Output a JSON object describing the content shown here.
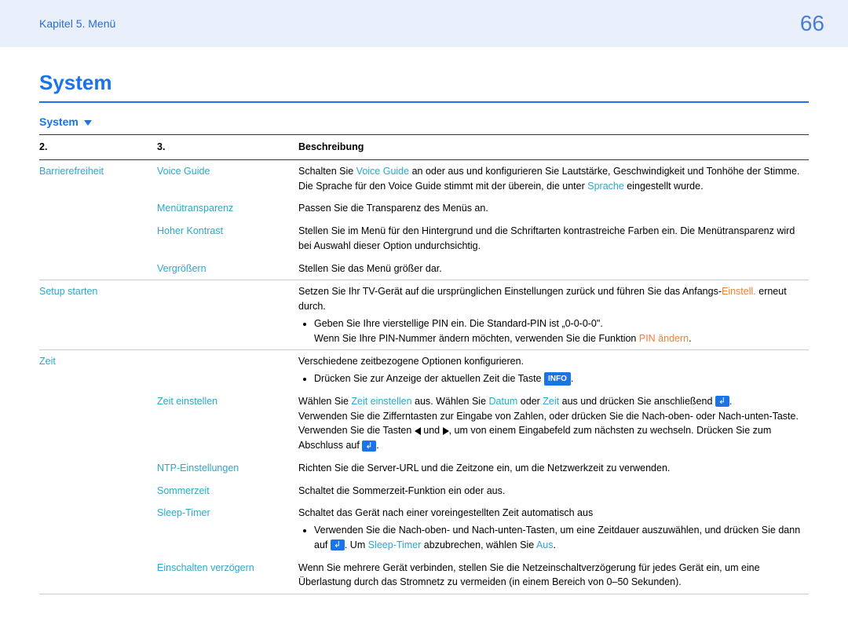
{
  "header": {
    "chapter": "Kapitel 5. Menü",
    "page": "66"
  },
  "main_title": "System",
  "sub_heading": "System",
  "table_headers": {
    "c2": "2.",
    "c3": "3.",
    "desc": "Beschreibung"
  },
  "rows": {
    "barrierefreiheit": {
      "label": "Barrierefreiheit",
      "voice_guide": {
        "label": "Voice Guide",
        "d1": "Schalten Sie ",
        "d2": "Voice Guide",
        "d3": " an oder aus und konfigurieren Sie Lautstärke, Geschwindigkeit und Tonhöhe der Stimme. Die Sprache für den Voice Guide stimmt mit der überein, die unter ",
        "d4": "Sprache",
        "d5": " eingestellt wurde."
      },
      "menutransparenz": {
        "label": "Menütransparenz",
        "desc": "Passen Sie die Transparenz des Menüs an."
      },
      "hoher_kontrast": {
        "label": "Hoher Kontrast",
        "desc": "Stellen Sie im Menü für den Hintergrund und die Schriftarten kontrastreiche Farben ein. Die Menütransparenz wird bei Auswahl dieser Option undurchsichtig."
      },
      "vergroessern": {
        "label": "Vergrößern",
        "desc": "Stellen Sie das Menü größer dar."
      }
    },
    "setup": {
      "label": "Setup starten",
      "d1": "Setzen Sie Ihr TV-Gerät auf die ursprünglichen Einstellungen zurück und führen Sie das Anfangs-",
      "d2": "Einstell.",
      "d3": " erneut durch.",
      "b1": "Geben Sie Ihre vierstellige PIN ein. Die Standard-PIN ist „0-0-0-0\".",
      "b2a": "Wenn Sie Ihre PIN-Nummer ändern möchten, verwenden Sie die Funktion ",
      "b2b": "PIN ändern",
      "b2c": "."
    },
    "zeit": {
      "label": "Zeit",
      "d1": "Verschiedene zeitbezogene Optionen konfigurieren.",
      "b1": "Drücken Sie zur Anzeige der aktuellen Zeit die Taste ",
      "info": "INFO",
      "b1end": "."
    },
    "zeit_einstellen": {
      "label": "Zeit einstellen",
      "d1": "Wählen Sie ",
      "d2": "Zeit einstellen",
      "d3": " aus. Wählen Sie ",
      "d4": "Datum",
      "d5": " oder ",
      "d6": "Zeit",
      "d7": " aus und drücken Sie anschließend ",
      "d8": ".",
      "p2a": "Verwenden Sie die Zifferntasten zur Eingabe von Zahlen, oder drücken Sie die Nach-oben- oder Nach-unten-Taste. Verwenden Sie die Tasten ",
      "p2b": " und ",
      "p2c": ", um von einem Eingabefeld zum nächsten zu wechseln. Drücken Sie zum Abschluss auf ",
      "p2d": "."
    },
    "ntp": {
      "label": "NTP-Einstellungen",
      "desc": "Richten Sie die Server-URL und die Zeitzone ein, um die Netzwerkzeit zu verwenden."
    },
    "sommerzeit": {
      "label": "Sommerzeit",
      "desc": "Schaltet die Sommerzeit-Funktion ein oder aus."
    },
    "sleep": {
      "label": "Sleep-Timer",
      "d1": "Schaltet das Gerät nach einer voreingestellten Zeit automatisch aus",
      "b1a": "Verwenden Sie die Nach-oben- und Nach-unten-Tasten, um eine Zeitdauer auszuwählen, und drücken Sie dann auf ",
      "b1b": ". Um ",
      "b1c": "Sleep-Timer",
      "b1d": " abzubrechen, wählen Sie ",
      "b1e": "Aus",
      "b1f": "."
    },
    "einschalten": {
      "label": "Einschalten verzögern",
      "desc": "Wenn Sie mehrere Gerät verbinden, stellen Sie die Netzeinschaltverzögerung für jedes Gerät ein, um eine Überlastung durch das Stromnetz zu vermeiden (in einem Bereich von 0–50 Sekunden)."
    }
  }
}
